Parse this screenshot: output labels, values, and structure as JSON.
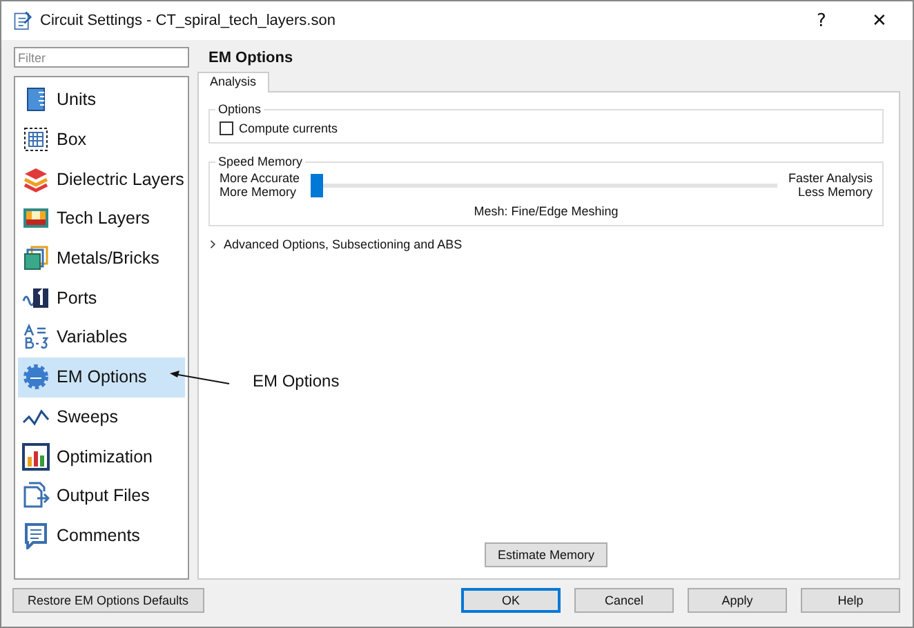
{
  "window": {
    "title": "Circuit Settings - CT_spiral_tech_layers.son",
    "help": "?",
    "close": "✕"
  },
  "filter": {
    "placeholder": "Filter"
  },
  "sidebar": {
    "items": [
      {
        "label": "Units",
        "selected": false
      },
      {
        "label": "Box",
        "selected": false
      },
      {
        "label": "Dielectric Layers",
        "selected": false
      },
      {
        "label": "Tech Layers",
        "selected": false
      },
      {
        "label": "Metals/Bricks",
        "selected": false
      },
      {
        "label": "Ports",
        "selected": false
      },
      {
        "label": "Variables",
        "selected": false
      },
      {
        "label": "EM Options",
        "selected": true
      },
      {
        "label": "Sweeps",
        "selected": false
      },
      {
        "label": "Optimization",
        "selected": false
      },
      {
        "label": "Output Files",
        "selected": false
      },
      {
        "label": "Comments",
        "selected": false
      }
    ]
  },
  "heading": "EM Options",
  "tabs": [
    {
      "label": "Analysis",
      "selected": true
    }
  ],
  "options": {
    "title": "Options",
    "compute_currents": {
      "label": "Compute currents",
      "checked": false
    }
  },
  "speed_memory": {
    "title": "Speed Memory",
    "left_labels": [
      "More Accurate",
      "More Memory"
    ],
    "right_labels": [
      "Faster Analysis",
      "Less Memory"
    ],
    "level": 0,
    "mesh": "Mesh: Fine/Edge Meshing"
  },
  "advanced": {
    "label": "Advanced Options, Subsectioning and ABS",
    "expanded": false
  },
  "estimate_button": "Estimate Memory",
  "restore_button": "Restore EM Options Defaults",
  "buttons": [
    "OK",
    "Cancel",
    "Apply",
    "Help"
  ],
  "callout": "EM Options"
}
